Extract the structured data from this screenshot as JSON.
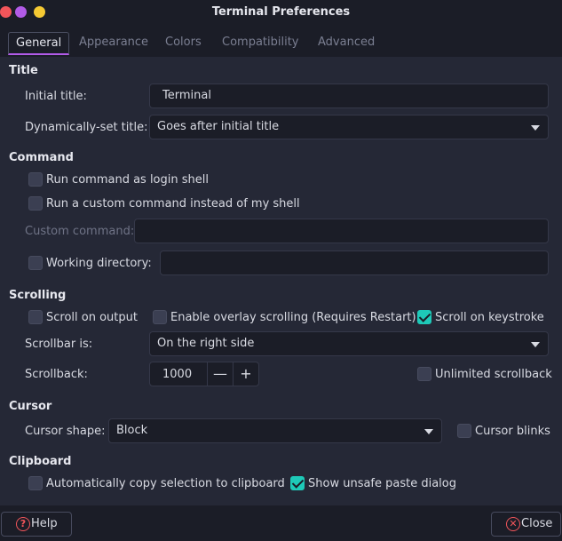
{
  "window": {
    "title": "Terminal Preferences"
  },
  "tabs": [
    {
      "label": "General",
      "active": true
    },
    {
      "label": "Appearance"
    },
    {
      "label": "Colors"
    },
    {
      "label": "Compatibility"
    },
    {
      "label": "Advanced"
    }
  ],
  "title_section": {
    "heading": "Title",
    "initial_title_label": "Initial title:",
    "initial_title_value": "Terminal",
    "dynamic_title_label": "Dynamically-set title:",
    "dynamic_title_value": "Goes after initial title"
  },
  "command_section": {
    "heading": "Command",
    "login_shell_label": "Run command as login shell",
    "login_shell_checked": false,
    "custom_command_check_label": "Run a custom command instead of my shell",
    "custom_command_check_checked": false,
    "custom_command_label": "Custom command:",
    "custom_command_value": "",
    "working_dir_label": "Working directory:",
    "working_dir_checked": false,
    "working_dir_value": ""
  },
  "scrolling_section": {
    "heading": "Scrolling",
    "scroll_on_output_label": "Scroll on output",
    "scroll_on_output_checked": false,
    "overlay_scrolling_label": "Enable overlay scrolling (Requires Restart)",
    "overlay_scrolling_checked": false,
    "scroll_on_keystroke_label": "Scroll on keystroke",
    "scroll_on_keystroke_checked": true,
    "scrollbar_label": "Scrollbar is:",
    "scrollbar_value": "On the right side",
    "scrollback_label": "Scrollback:",
    "scrollback_value": "1000",
    "minus_symbol": "—",
    "plus_symbol": "+",
    "unlimited_label": "Unlimited scrollback",
    "unlimited_checked": false
  },
  "cursor_section": {
    "heading": "Cursor",
    "shape_label": "Cursor shape:",
    "shape_value": "Block",
    "blinks_label": "Cursor blinks",
    "blinks_checked": false
  },
  "clipboard_section": {
    "heading": "Clipboard",
    "auto_copy_label": "Automatically copy selection to clipboard",
    "auto_copy_checked": false,
    "unsafe_paste_label": "Show unsafe paste dialog",
    "unsafe_paste_checked": true
  },
  "footer": {
    "help_label": "Help",
    "help_icon": "help-icon",
    "help_glyph": "?",
    "close_label": "Close",
    "close_icon": "close-icon",
    "close_glyph": "✕"
  },
  "colors": {
    "accent_purple": "#b25be8",
    "accent_teal": "#1ec9b8",
    "window_close": "#f2555a",
    "window_min": "#b25be8",
    "window_max": "#f5c933"
  }
}
